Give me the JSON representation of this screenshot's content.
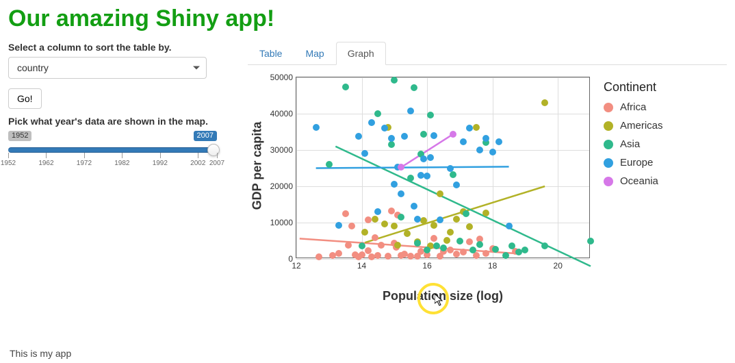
{
  "header": {
    "title": "Our amazing Shiny app!"
  },
  "sidebar": {
    "sort_label": "Select a column to sort the table by.",
    "sort_selected": "country",
    "go_label": "Go!",
    "slider_label": "Pick what year's data are shown in the map.",
    "slider_min": "1952",
    "slider_max": "2007",
    "slider_ticks": [
      {
        "pct": 0,
        "label": "1952"
      },
      {
        "pct": 18.18,
        "label": "1962"
      },
      {
        "pct": 36.36,
        "label": "1972"
      },
      {
        "pct": 54.55,
        "label": "1982"
      },
      {
        "pct": 72.73,
        "label": "1992"
      },
      {
        "pct": 90.91,
        "label": "2002"
      },
      {
        "pct": 100,
        "label": "2007"
      }
    ]
  },
  "tabs": {
    "items": [
      {
        "label": "Table",
        "active": false
      },
      {
        "label": "Map",
        "active": false
      },
      {
        "label": "Graph",
        "active": true
      }
    ]
  },
  "footer_text": "This is my app",
  "chart_data": {
    "type": "scatter",
    "title": "",
    "xlabel": "Population size (log)",
    "ylabel": "GDP per capita",
    "xlim": [
      12,
      21
    ],
    "ylim": [
      0,
      50000
    ],
    "xticks": [
      12,
      14,
      16,
      18,
      20
    ],
    "yticks": [
      0,
      10000,
      20000,
      30000,
      40000,
      50000
    ],
    "legend_title": "Continent",
    "colors": {
      "Africa": "#f28e81",
      "Americas": "#b2b227",
      "Asia": "#2fb98c",
      "Europe": "#31a0e0",
      "Oceania": "#d678e8"
    },
    "legend": [
      "Africa",
      "Americas",
      "Asia",
      "Europe",
      "Oceania"
    ],
    "series": [
      {
        "name": "Africa",
        "points": [
          [
            12.7,
            500
          ],
          [
            13.1,
            900
          ],
          [
            13.3,
            1500
          ],
          [
            13.5,
            12500
          ],
          [
            13.6,
            3800
          ],
          [
            13.7,
            9000
          ],
          [
            13.8,
            1200
          ],
          [
            13.9,
            500
          ],
          [
            14.0,
            1200
          ],
          [
            14.2,
            10700
          ],
          [
            14.2,
            2200
          ],
          [
            14.3,
            600
          ],
          [
            14.4,
            5800
          ],
          [
            14.5,
            1000
          ],
          [
            14.6,
            3800
          ],
          [
            14.8,
            800
          ],
          [
            14.9,
            13200
          ],
          [
            15.0,
            4400
          ],
          [
            15.05,
            3200
          ],
          [
            15.1,
            12000
          ],
          [
            15.2,
            900
          ],
          [
            15.3,
            1300
          ],
          [
            15.5,
            800
          ],
          [
            15.7,
            700
          ],
          [
            15.8,
            2000
          ],
          [
            16.0,
            1200
          ],
          [
            16.2,
            5700
          ],
          [
            16.4,
            800
          ],
          [
            16.5,
            2000
          ],
          [
            16.7,
            2400
          ],
          [
            16.9,
            1300
          ],
          [
            17.1,
            1800
          ],
          [
            17.3,
            4700
          ],
          [
            17.5,
            900
          ],
          [
            17.6,
            5400
          ],
          [
            17.8,
            1500
          ],
          [
            18.0,
            2800
          ],
          [
            18.7,
            2000
          ]
        ]
      },
      {
        "name": "Americas",
        "points": [
          [
            14.1,
            7300
          ],
          [
            14.4,
            10900
          ],
          [
            14.7,
            9600
          ],
          [
            14.8,
            36200
          ],
          [
            15.0,
            9000
          ],
          [
            15.1,
            3800
          ],
          [
            15.4,
            7000
          ],
          [
            15.7,
            4800
          ],
          [
            15.9,
            10600
          ],
          [
            16.1,
            3500
          ],
          [
            16.2,
            9200
          ],
          [
            16.4,
            18000
          ],
          [
            16.6,
            5100
          ],
          [
            16.7,
            7400
          ],
          [
            16.9,
            11000
          ],
          [
            17.1,
            13000
          ],
          [
            17.3,
            8900
          ],
          [
            17.5,
            36200
          ],
          [
            17.8,
            12700
          ],
          [
            19.6,
            43000
          ]
        ]
      },
      {
        "name": "Asia",
        "points": [
          [
            13.0,
            26000
          ],
          [
            13.5,
            47300
          ],
          [
            14.0,
            3500
          ],
          [
            14.5,
            40000
          ],
          [
            14.9,
            31600
          ],
          [
            15.0,
            49300
          ],
          [
            15.2,
            11600
          ],
          [
            15.5,
            22300
          ],
          [
            15.6,
            47100
          ],
          [
            15.7,
            4400
          ],
          [
            15.8,
            28800
          ],
          [
            15.9,
            34400
          ],
          [
            16.0,
            2500
          ],
          [
            16.1,
            39700
          ],
          [
            16.3,
            3500
          ],
          [
            16.5,
            3100
          ],
          [
            16.8,
            23300
          ],
          [
            17.0,
            4900
          ],
          [
            17.2,
            12400
          ],
          [
            17.4,
            2400
          ],
          [
            17.6,
            4000
          ],
          [
            17.8,
            32000
          ],
          [
            18.1,
            2600
          ],
          [
            18.4,
            1000
          ],
          [
            18.6,
            3500
          ],
          [
            18.8,
            1800
          ],
          [
            19.0,
            2400
          ],
          [
            19.6,
            3500
          ],
          [
            21.0,
            5000
          ]
        ]
      },
      {
        "name": "Europe",
        "points": [
          [
            12.6,
            36300
          ],
          [
            13.3,
            9200
          ],
          [
            13.9,
            33800
          ],
          [
            14.1,
            29000
          ],
          [
            14.3,
            37500
          ],
          [
            14.5,
            13000
          ],
          [
            14.7,
            36000
          ],
          [
            14.9,
            33200
          ],
          [
            15.0,
            20500
          ],
          [
            15.1,
            25200
          ],
          [
            15.2,
            18000
          ],
          [
            15.3,
            33700
          ],
          [
            15.5,
            40700
          ],
          [
            15.6,
            14600
          ],
          [
            15.7,
            11000
          ],
          [
            15.8,
            23000
          ],
          [
            15.9,
            27500
          ],
          [
            16.0,
            22800
          ],
          [
            16.1,
            28000
          ],
          [
            16.2,
            34000
          ],
          [
            16.4,
            10800
          ],
          [
            16.7,
            25000
          ],
          [
            16.9,
            20300
          ],
          [
            17.1,
            32200
          ],
          [
            17.3,
            36000
          ],
          [
            17.6,
            30000
          ],
          [
            17.8,
            33200
          ],
          [
            18.0,
            29500
          ],
          [
            18.2,
            32200
          ],
          [
            18.5,
            9000
          ]
        ]
      },
      {
        "name": "Oceania",
        "points": [
          [
            15.2,
            25200
          ],
          [
            16.8,
            34400
          ]
        ]
      }
    ],
    "trendlines": [
      {
        "name": "Africa",
        "x1": 12.1,
        "y1": 5600,
        "x2": 18.7,
        "y2": 1500
      },
      {
        "name": "Americas",
        "x1": 14.1,
        "y1": 4500,
        "x2": 19.6,
        "y2": 20000
      },
      {
        "name": "Asia",
        "x1": 13.2,
        "y1": 31000,
        "x2": 21.0,
        "y2": -2000
      },
      {
        "name": "Europe",
        "x1": 12.6,
        "y1": 25000,
        "x2": 18.5,
        "y2": 25400
      },
      {
        "name": "Oceania",
        "x1": 15.2,
        "y1": 25200,
        "x2": 16.8,
        "y2": 34400
      }
    ]
  }
}
